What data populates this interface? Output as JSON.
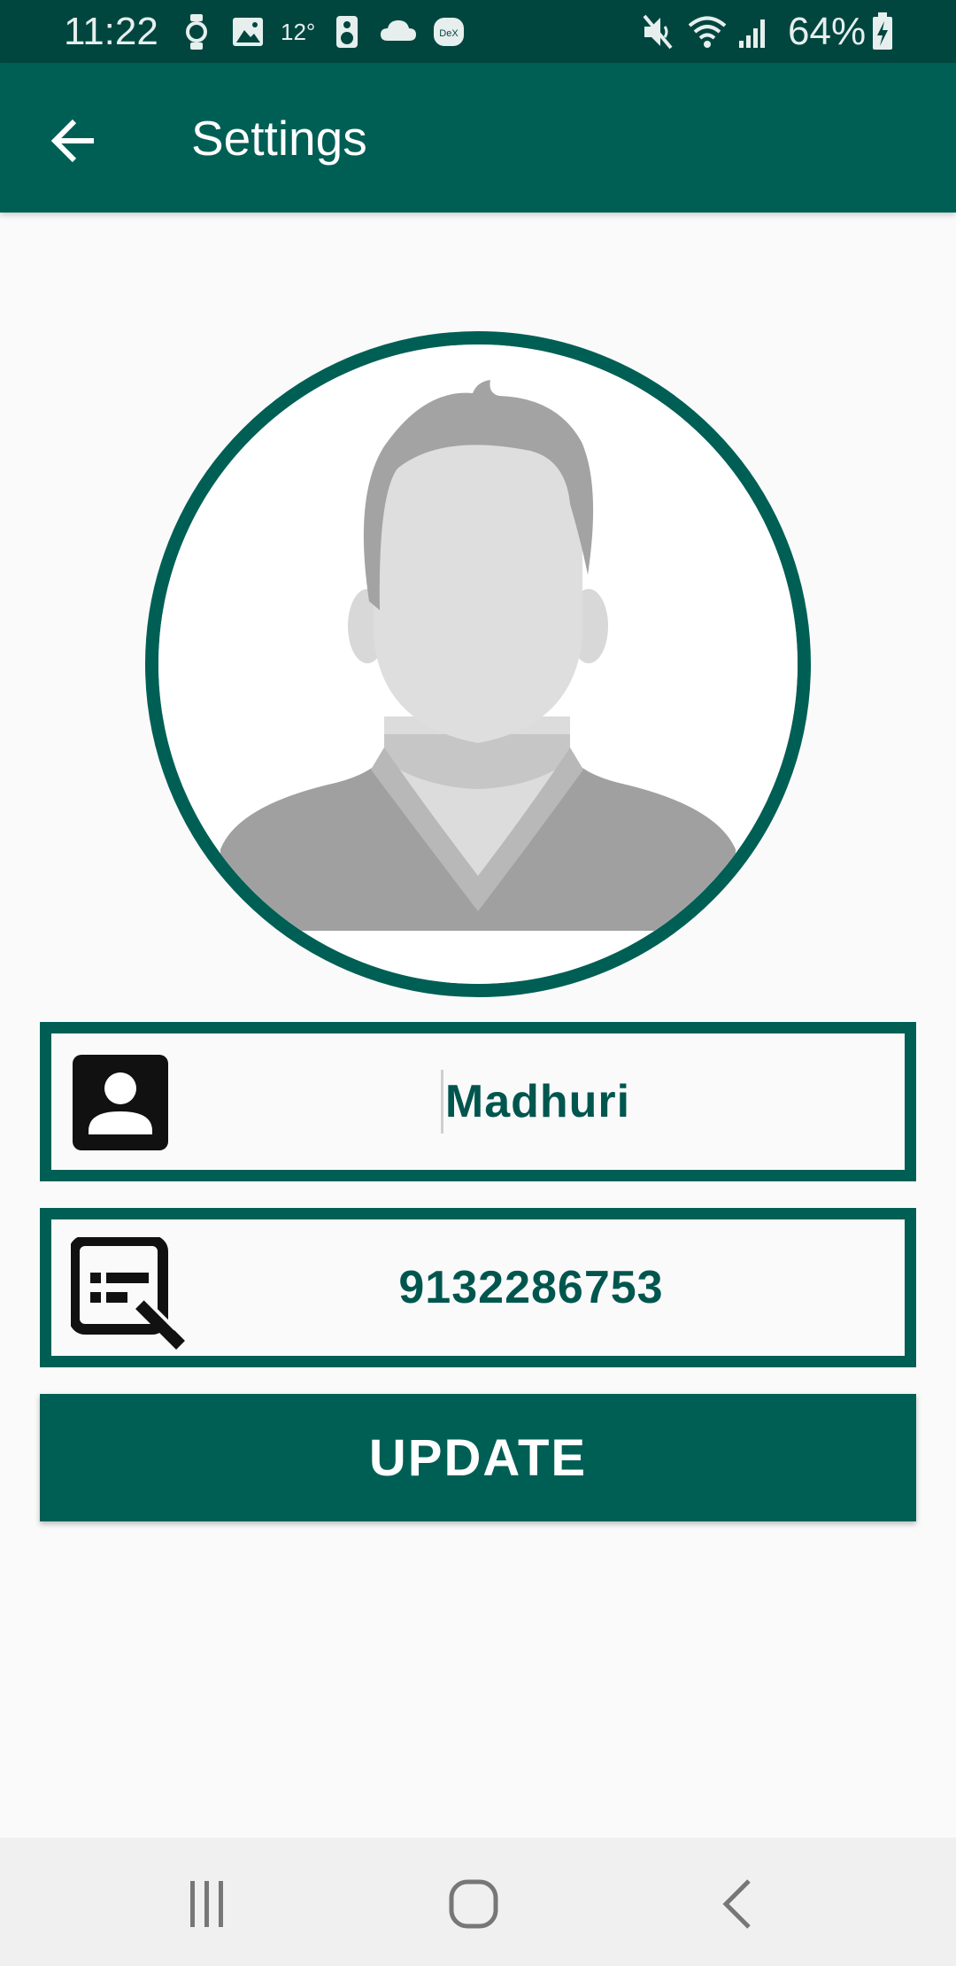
{
  "status_bar": {
    "time": "11:22",
    "temperature": "12°",
    "dex_label": "DeX",
    "battery": "64%",
    "icons": [
      "watch-icon",
      "gallery-icon",
      "temperature-icon",
      "speaker-icon",
      "cloud-icon",
      "dex-icon",
      "mute-icon",
      "wifi-icon",
      "signal-icon",
      "battery-charging-icon"
    ]
  },
  "app_bar": {
    "back_icon": "arrow-left-icon",
    "title": "Settings"
  },
  "profile": {
    "avatar_icon": "default-avatar-icon",
    "name": "Madhuri",
    "phone": "9132286753",
    "name_icon": "account-box-icon",
    "phone_icon": "edit-details-icon"
  },
  "actions": {
    "update_label": "UPDATE"
  },
  "nav_bar": {
    "recent_icon": "recent-apps-icon",
    "home_icon": "home-icon",
    "back_icon": "back-icon"
  },
  "colors": {
    "primary": "#005f55",
    "status_bar": "#00463f",
    "text_value": "#00564e",
    "background": "#fafafa"
  }
}
